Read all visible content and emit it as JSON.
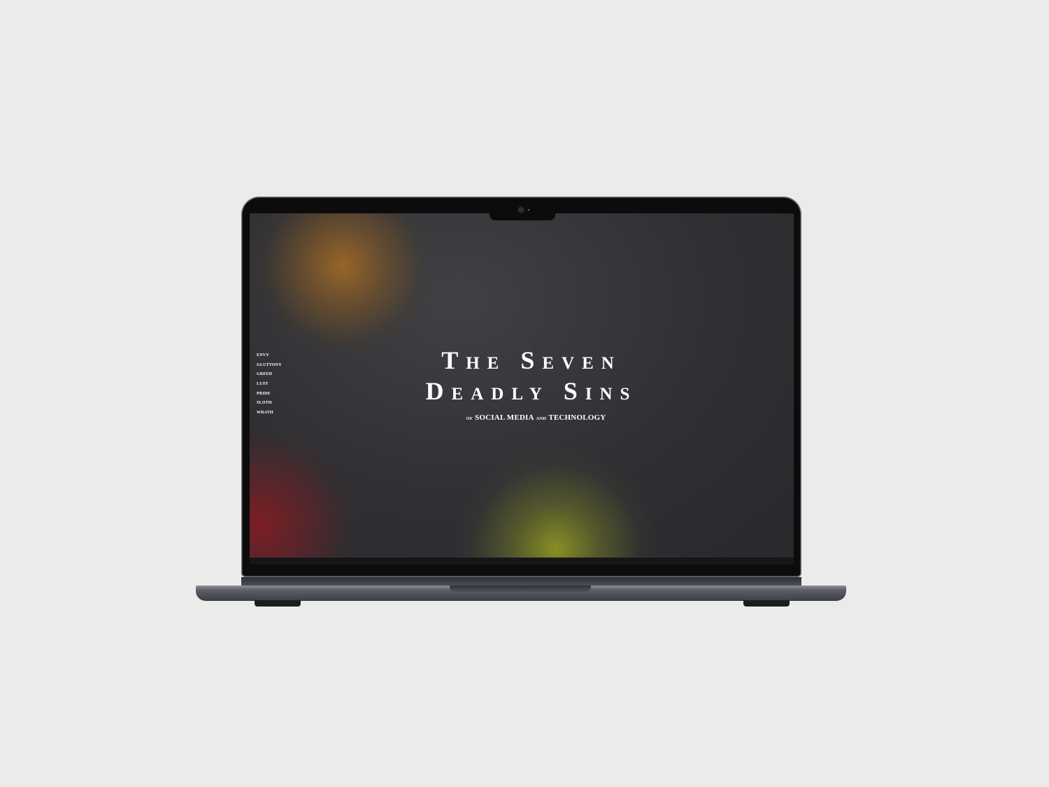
{
  "device": {
    "type": "laptop-mockup",
    "background_color": "#ebebea"
  },
  "site": {
    "nav": {
      "items": [
        {
          "label": "ENVY"
        },
        {
          "label": "GLUTTONY"
        },
        {
          "label": "GREED"
        },
        {
          "label": "LUST"
        },
        {
          "label": "PRIDE"
        },
        {
          "label": "SLOTH"
        },
        {
          "label": "WRATH"
        }
      ]
    },
    "hero": {
      "title_line1": "The Seven",
      "title_line2": "Deadly Sins",
      "subtitle_of": "OF",
      "subtitle_part1": "SOCIAL MEDIA",
      "subtitle_and": "AND",
      "subtitle_part2": "TECHNOLOGY"
    },
    "colors": {
      "screen_bg": "#2f3033",
      "orb_orange": "#9c6828",
      "orb_red": "#801e24",
      "orb_yellow": "#8c9424",
      "text": "#ffffff"
    }
  }
}
